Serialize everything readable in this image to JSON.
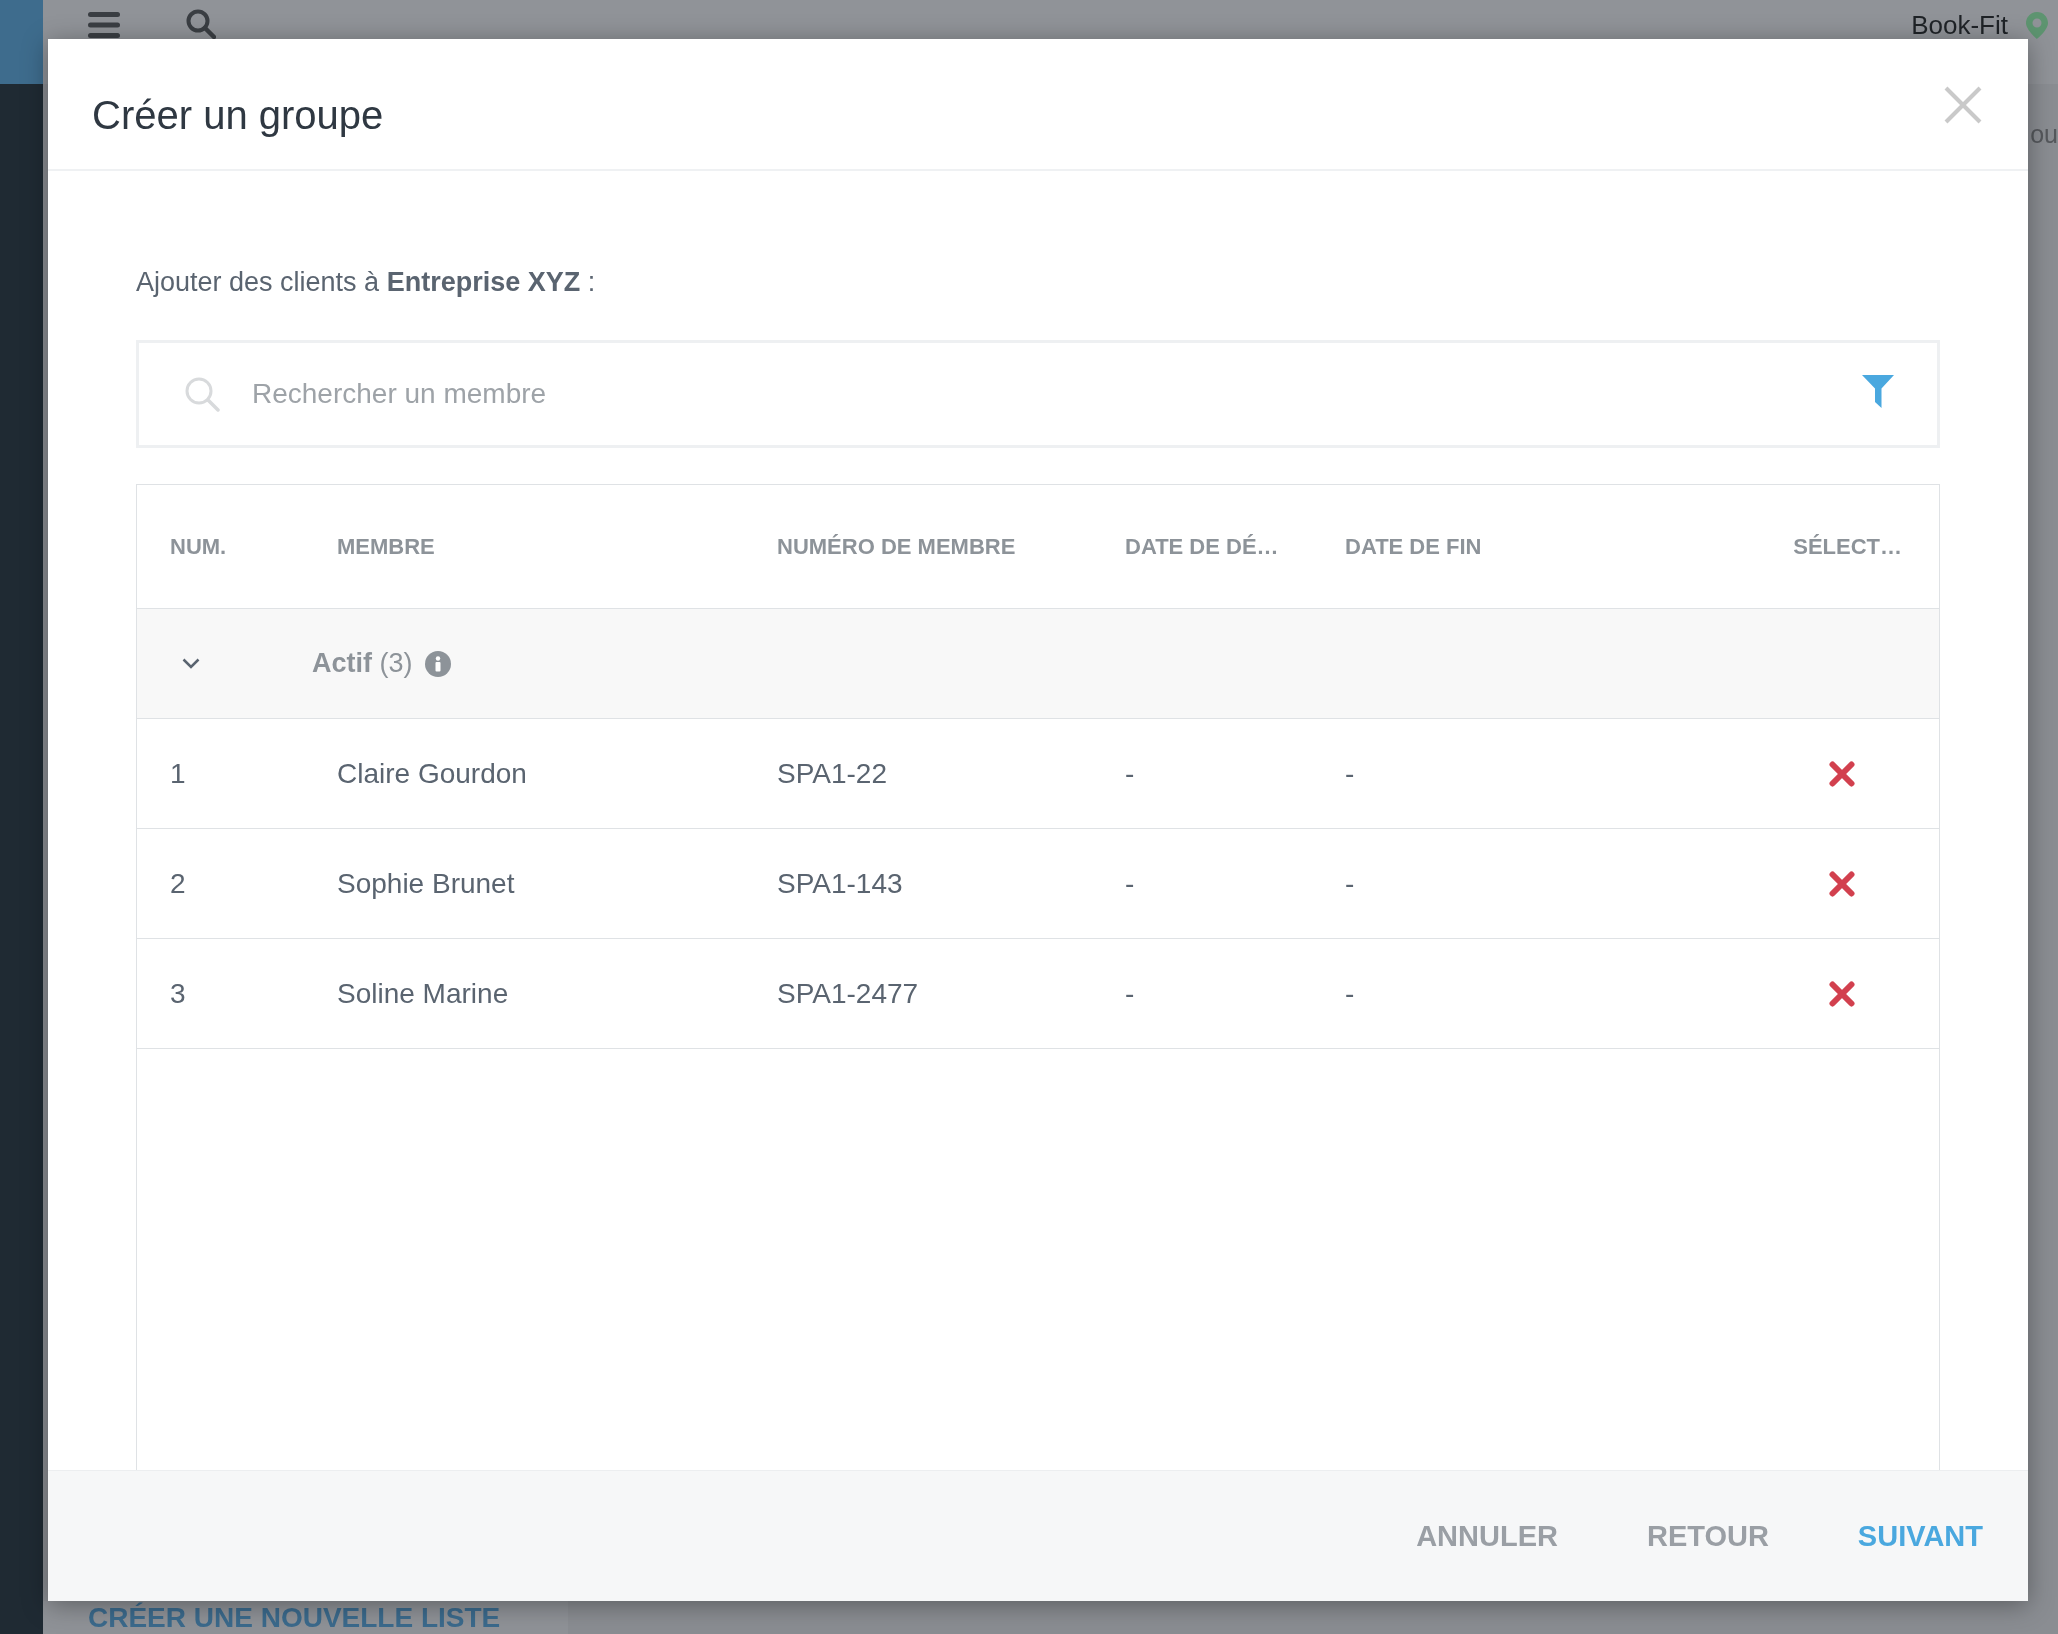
{
  "app_bar": {
    "brand": "Book-Fit"
  },
  "background": {
    "partial_text": "ou",
    "link": "CRÉER UNE NOUVELLE LISTE"
  },
  "dialog": {
    "title": "Créer un groupe",
    "intro": "Ajouter des clients à **Entreprise XYZ** :",
    "search": {
      "placeholder": "Rechercher un membre"
    },
    "table": {
      "columns": [
        "NUM.",
        "MEMBRE",
        "NUMÉRO DE MEMBRE",
        "DATE DE DÉ…",
        "DATE DE FIN",
        "SÉLECT…"
      ],
      "groups": [
        {
          "label": "**Actif** (3)",
          "expanded": true,
          "rows": [
            {
              "cells": [
                "1",
                "Claire Gourdon",
                "SPA1-22",
                "-",
                "-"
              ]
            },
            {
              "cells": [
                "2",
                "Sophie Brunet",
                "SPA1-143",
                "-",
                "-"
              ]
            },
            {
              "cells": [
                "3",
                "Soline Marine",
                "SPA1-2477",
                "-",
                "-"
              ]
            }
          ]
        }
      ]
    },
    "buttons": [
      {
        "label": "ANNULER",
        "kind": "secondary"
      },
      {
        "label": "RETOUR",
        "kind": "secondary"
      },
      {
        "label": "SUIVANT",
        "kind": "primary"
      }
    ]
  }
}
